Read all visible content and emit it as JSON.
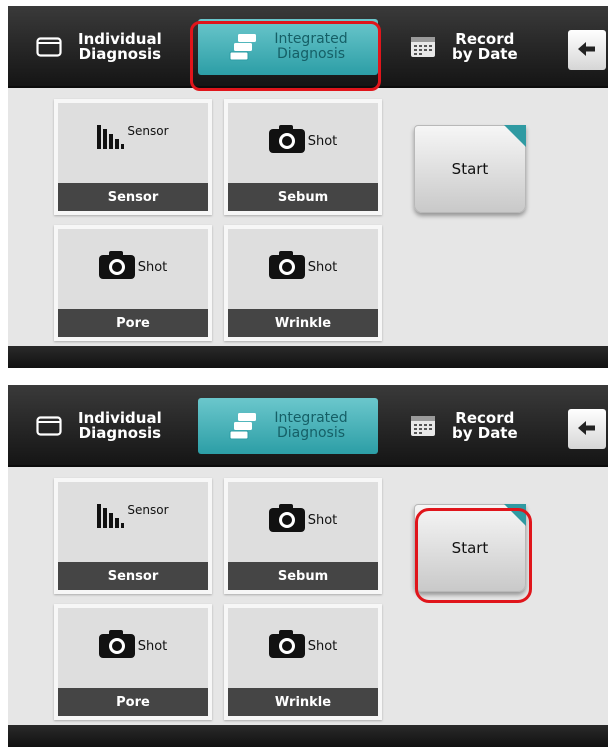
{
  "screens": [
    {
      "tabs": {
        "individual": {
          "line1": "Individual",
          "line2": "Diagnosis"
        },
        "integrated": {
          "line1": "Integrated",
          "line2": "Diagnosis"
        },
        "record": {
          "line1": "Record",
          "line2": "by Date"
        }
      },
      "tiles": [
        {
          "label": "Sensor",
          "caption": "Sensor"
        },
        {
          "label": "Shot",
          "caption": "Sebum"
        },
        {
          "label": "Shot",
          "caption": "Pore"
        },
        {
          "label": "Shot",
          "caption": "Wrinkle"
        }
      ],
      "start_label": "Start"
    },
    {
      "tabs": {
        "individual": {
          "line1": "Individual",
          "line2": "Diagnosis"
        },
        "integrated": {
          "line1": "Integrated",
          "line2": "Diagnosis"
        },
        "record": {
          "line1": "Record",
          "line2": "by Date"
        }
      },
      "tiles": [
        {
          "label": "Sensor",
          "caption": "Sensor"
        },
        {
          "label": "Shot",
          "caption": "Sebum"
        },
        {
          "label": "Shot",
          "caption": "Pore"
        },
        {
          "label": "Shot",
          "caption": "Wrinkle"
        }
      ],
      "start_label": "Start"
    }
  ],
  "icons": {
    "individual": "window-icon",
    "integrated": "stacked-windows-icon",
    "record": "calendar-keypad-icon",
    "back": "arrow-left-icon",
    "sensor": "bar-chart-icon",
    "shot": "camera-icon"
  },
  "colors": {
    "accent": "#2c9ea6",
    "highlight": "#e0151b",
    "caption_bg": "#454545",
    "topbar": "#1f1f1f"
  }
}
